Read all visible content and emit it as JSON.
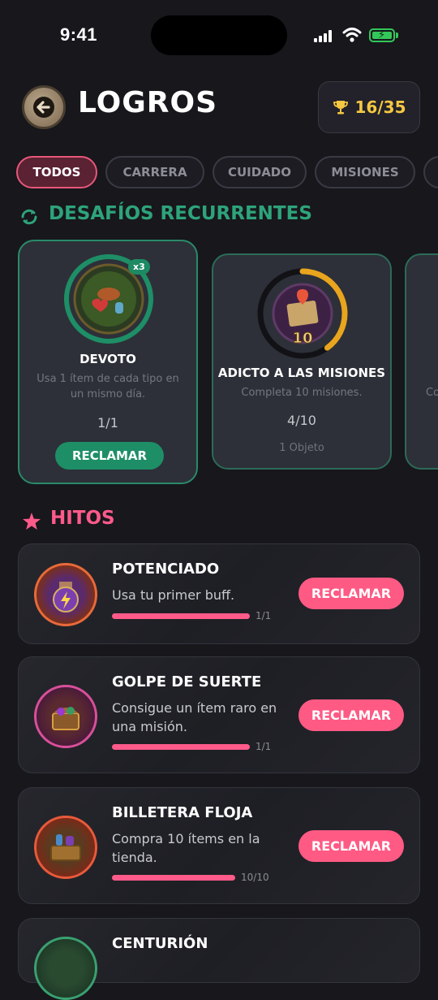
{
  "status": {
    "time": "9:41"
  },
  "header": {
    "title": "LOGROS",
    "trophy_count": "16/35"
  },
  "tabs": [
    {
      "label": "TODOS",
      "active": true
    },
    {
      "label": "CARRERA",
      "active": false
    },
    {
      "label": "CUIDADO",
      "active": false
    },
    {
      "label": "MISIONES",
      "active": false
    }
  ],
  "recurring": {
    "title": "DESAFÍOS RECURRENTES",
    "cards": [
      {
        "name": "DEVOTO",
        "desc": "Usa 1 ítem de cada tipo en un mismo día.",
        "progress": "1/1",
        "badge": "x3",
        "ring_fraction": 1.0,
        "action": "RECLAMAR"
      },
      {
        "name": "ADICTO A LAS MISIONES",
        "desc": "Completa 10 misiones.",
        "progress": "4/10",
        "reward": "1 Objeto",
        "medal_number": "10",
        "ring_fraction": 0.4
      },
      {
        "desc_partial": "Co"
      }
    ]
  },
  "milestones": {
    "title": "HITOS",
    "items": [
      {
        "title": "POTENCIADO",
        "desc": "Usa tu primer buff.",
        "progress": "1/1",
        "progress_fraction": 1.0,
        "action": "RECLAMAR"
      },
      {
        "title": "GOLPE DE SUERTE",
        "desc": "Consigue un ítem raro en una misión.",
        "progress": "1/1",
        "progress_fraction": 1.0,
        "action": "RECLAMAR"
      },
      {
        "title": "BILLETERA FLOJA",
        "desc": "Compra 10 ítems en la tienda.",
        "progress": "10/10",
        "progress_fraction": 1.0,
        "action": "RECLAMAR"
      },
      {
        "title": "CENTURIÓN"
      }
    ]
  },
  "colors": {
    "accent_pink": "#ff5a8a",
    "accent_green": "#2ea37a",
    "trophy_gold": "#f5c842"
  },
  "icons": [
    "back-arrow-icon",
    "trophy-icon",
    "refresh-icon",
    "star-icon"
  ]
}
